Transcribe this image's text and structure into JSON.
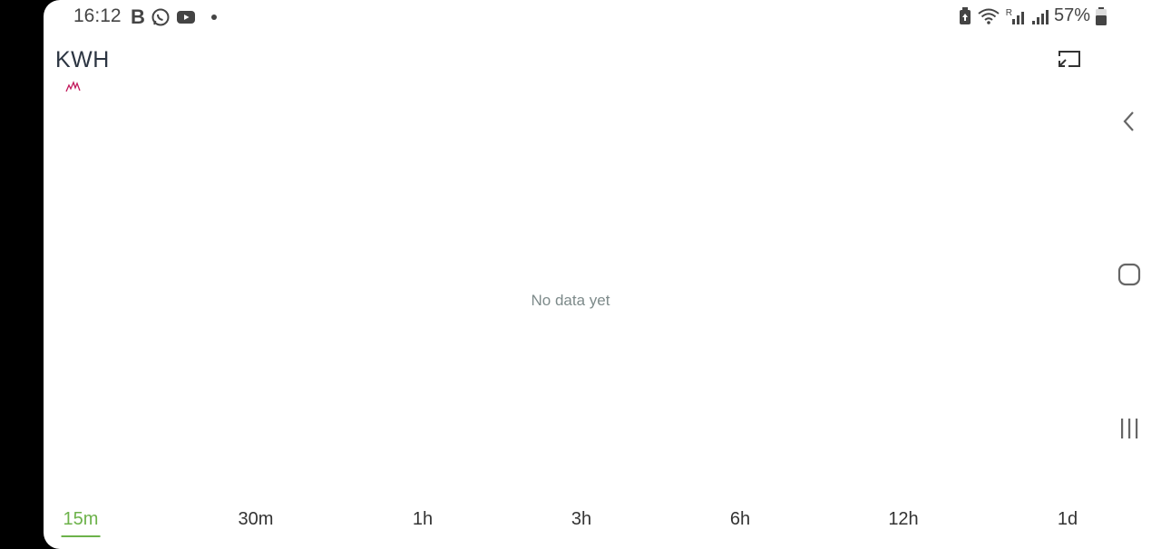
{
  "status_bar": {
    "time": "16:12",
    "left_icons": [
      "b-icon",
      "whatsapp-icon",
      "youtube-icon",
      "dot-icon"
    ],
    "b_label": "B",
    "battery_percent": "57%",
    "right_icons": [
      "battery-saver-icon",
      "wifi-icon",
      "signal-roaming-icon",
      "signal-icon",
      "battery-icon"
    ],
    "roaming_label": "R"
  },
  "header": {
    "title": "KWH",
    "sparkline_color": "#c2185b"
  },
  "chart": {
    "empty_message": "No data yet"
  },
  "range_tabs": [
    {
      "label": "15m",
      "active": true
    },
    {
      "label": "30m",
      "active": false
    },
    {
      "label": "1h",
      "active": false
    },
    {
      "label": "3h",
      "active": false
    },
    {
      "label": "6h",
      "active": false
    },
    {
      "label": "12h",
      "active": false
    },
    {
      "label": "1d",
      "active": false
    }
  ],
  "colors": {
    "accent": "#6cb24a",
    "title": "#2c3542",
    "empty_text": "#7d8a8a"
  },
  "nav_bar": {
    "buttons": [
      "back-icon",
      "home-icon",
      "recents-icon"
    ]
  }
}
